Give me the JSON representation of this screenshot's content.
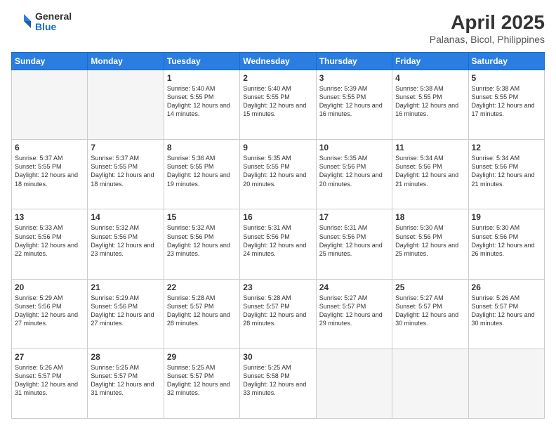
{
  "logo": {
    "general": "General",
    "blue": "Blue"
  },
  "title": {
    "month_year": "April 2025",
    "location": "Palanas, Bicol, Philippines"
  },
  "weekdays": [
    "Sunday",
    "Monday",
    "Tuesday",
    "Wednesday",
    "Thursday",
    "Friday",
    "Saturday"
  ],
  "weeks": [
    [
      {
        "day": "",
        "info": ""
      },
      {
        "day": "",
        "info": ""
      },
      {
        "day": "1",
        "info": "Sunrise: 5:40 AM\nSunset: 5:55 PM\nDaylight: 12 hours\nand 14 minutes."
      },
      {
        "day": "2",
        "info": "Sunrise: 5:40 AM\nSunset: 5:55 PM\nDaylight: 12 hours\nand 15 minutes."
      },
      {
        "day": "3",
        "info": "Sunrise: 5:39 AM\nSunset: 5:55 PM\nDaylight: 12 hours\nand 16 minutes."
      },
      {
        "day": "4",
        "info": "Sunrise: 5:38 AM\nSunset: 5:55 PM\nDaylight: 12 hours\nand 16 minutes."
      },
      {
        "day": "5",
        "info": "Sunrise: 5:38 AM\nSunset: 5:55 PM\nDaylight: 12 hours\nand 17 minutes."
      }
    ],
    [
      {
        "day": "6",
        "info": "Sunrise: 5:37 AM\nSunset: 5:55 PM\nDaylight: 12 hours\nand 18 minutes."
      },
      {
        "day": "7",
        "info": "Sunrise: 5:37 AM\nSunset: 5:55 PM\nDaylight: 12 hours\nand 18 minutes."
      },
      {
        "day": "8",
        "info": "Sunrise: 5:36 AM\nSunset: 5:55 PM\nDaylight: 12 hours\nand 19 minutes."
      },
      {
        "day": "9",
        "info": "Sunrise: 5:35 AM\nSunset: 5:55 PM\nDaylight: 12 hours\nand 20 minutes."
      },
      {
        "day": "10",
        "info": "Sunrise: 5:35 AM\nSunset: 5:56 PM\nDaylight: 12 hours\nand 20 minutes."
      },
      {
        "day": "11",
        "info": "Sunrise: 5:34 AM\nSunset: 5:56 PM\nDaylight: 12 hours\nand 21 minutes."
      },
      {
        "day": "12",
        "info": "Sunrise: 5:34 AM\nSunset: 5:56 PM\nDaylight: 12 hours\nand 21 minutes."
      }
    ],
    [
      {
        "day": "13",
        "info": "Sunrise: 5:33 AM\nSunset: 5:56 PM\nDaylight: 12 hours\nand 22 minutes."
      },
      {
        "day": "14",
        "info": "Sunrise: 5:32 AM\nSunset: 5:56 PM\nDaylight: 12 hours\nand 23 minutes."
      },
      {
        "day": "15",
        "info": "Sunrise: 5:32 AM\nSunset: 5:56 PM\nDaylight: 12 hours\nand 23 minutes."
      },
      {
        "day": "16",
        "info": "Sunrise: 5:31 AM\nSunset: 5:56 PM\nDaylight: 12 hours\nand 24 minutes."
      },
      {
        "day": "17",
        "info": "Sunrise: 5:31 AM\nSunset: 5:56 PM\nDaylight: 12 hours\nand 25 minutes."
      },
      {
        "day": "18",
        "info": "Sunrise: 5:30 AM\nSunset: 5:56 PM\nDaylight: 12 hours\nand 25 minutes."
      },
      {
        "day": "19",
        "info": "Sunrise: 5:30 AM\nSunset: 5:56 PM\nDaylight: 12 hours\nand 26 minutes."
      }
    ],
    [
      {
        "day": "20",
        "info": "Sunrise: 5:29 AM\nSunset: 5:56 PM\nDaylight: 12 hours\nand 27 minutes."
      },
      {
        "day": "21",
        "info": "Sunrise: 5:29 AM\nSunset: 5:56 PM\nDaylight: 12 hours\nand 27 minutes."
      },
      {
        "day": "22",
        "info": "Sunrise: 5:28 AM\nSunset: 5:57 PM\nDaylight: 12 hours\nand 28 minutes."
      },
      {
        "day": "23",
        "info": "Sunrise: 5:28 AM\nSunset: 5:57 PM\nDaylight: 12 hours\nand 28 minutes."
      },
      {
        "day": "24",
        "info": "Sunrise: 5:27 AM\nSunset: 5:57 PM\nDaylight: 12 hours\nand 29 minutes."
      },
      {
        "day": "25",
        "info": "Sunrise: 5:27 AM\nSunset: 5:57 PM\nDaylight: 12 hours\nand 30 minutes."
      },
      {
        "day": "26",
        "info": "Sunrise: 5:26 AM\nSunset: 5:57 PM\nDaylight: 12 hours\nand 30 minutes."
      }
    ],
    [
      {
        "day": "27",
        "info": "Sunrise: 5:26 AM\nSunset: 5:57 PM\nDaylight: 12 hours\nand 31 minutes."
      },
      {
        "day": "28",
        "info": "Sunrise: 5:25 AM\nSunset: 5:57 PM\nDaylight: 12 hours\nand 31 minutes."
      },
      {
        "day": "29",
        "info": "Sunrise: 5:25 AM\nSunset: 5:57 PM\nDaylight: 12 hours\nand 32 minutes."
      },
      {
        "day": "30",
        "info": "Sunrise: 5:25 AM\nSunset: 5:58 PM\nDaylight: 12 hours\nand 33 minutes."
      },
      {
        "day": "",
        "info": ""
      },
      {
        "day": "",
        "info": ""
      },
      {
        "day": "",
        "info": ""
      }
    ]
  ]
}
